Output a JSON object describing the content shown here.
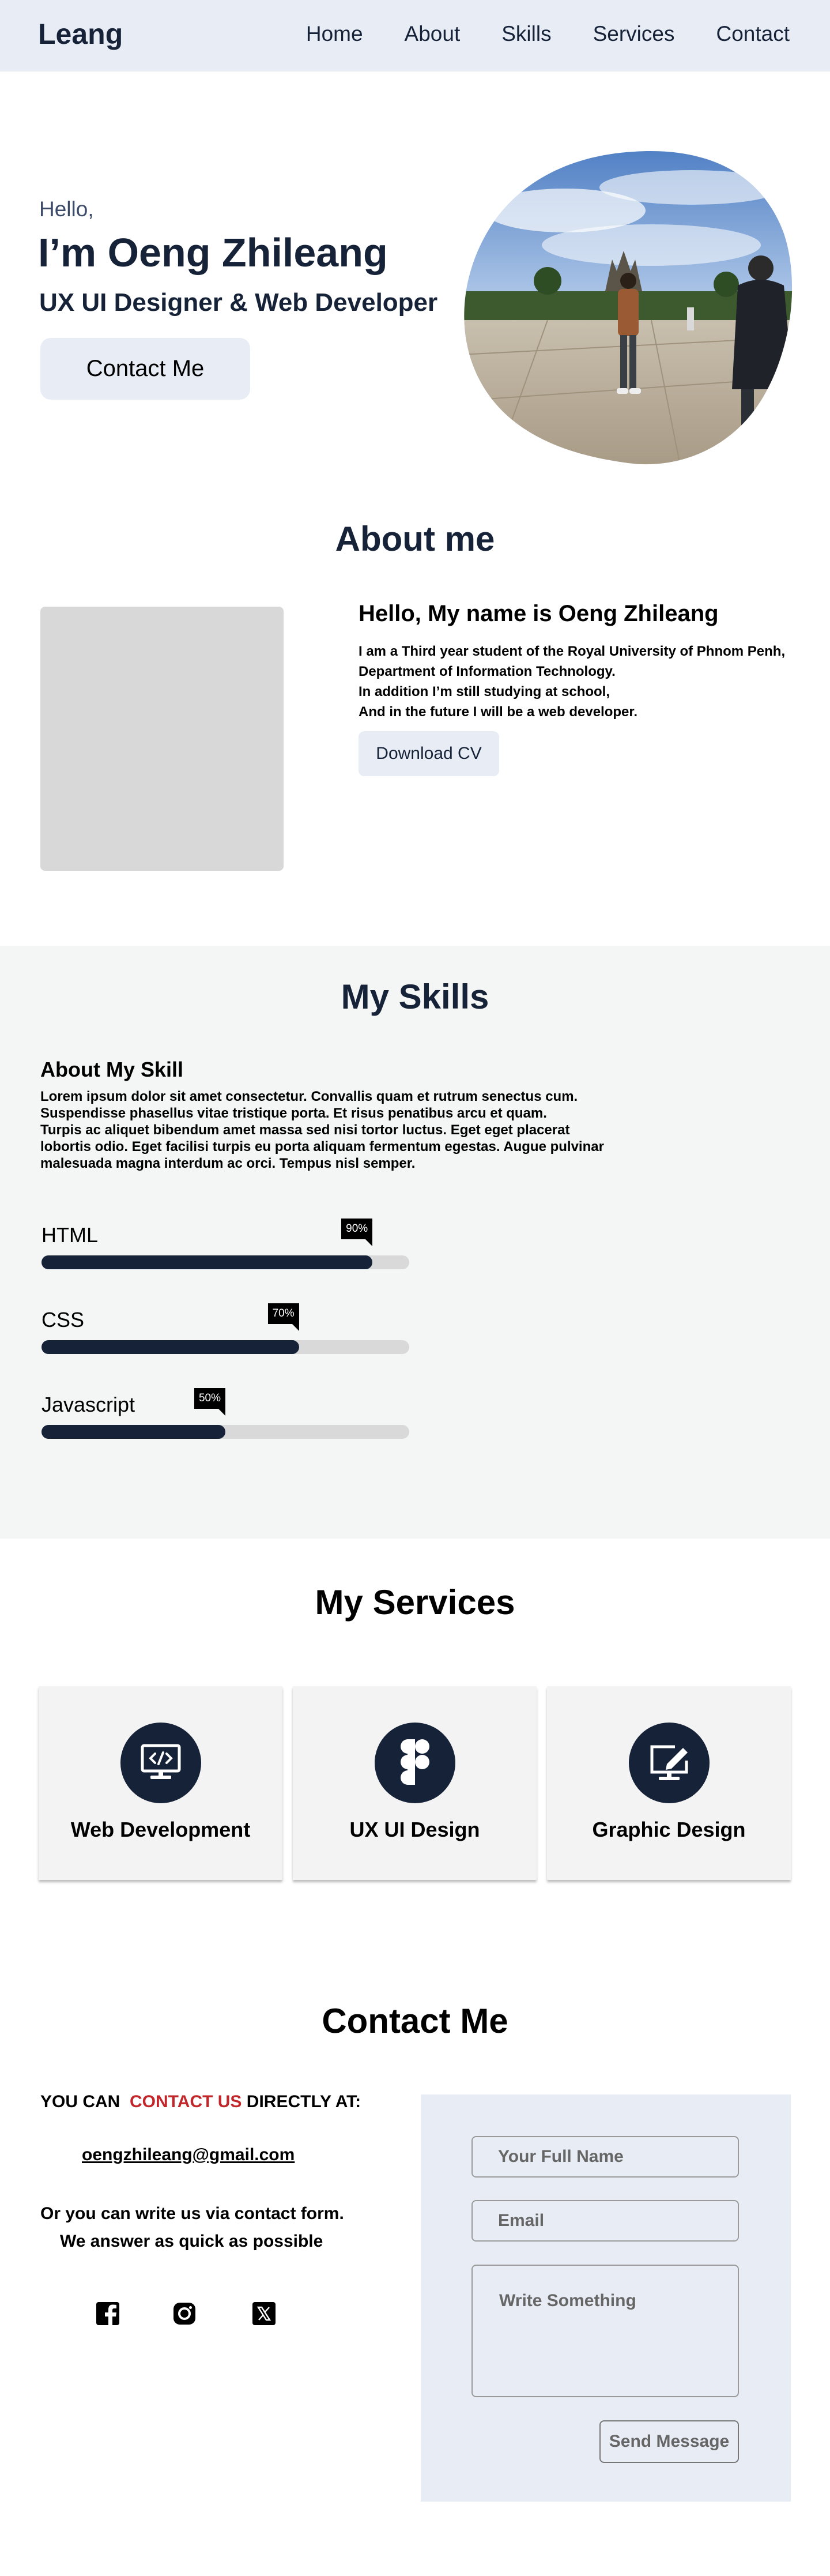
{
  "nav": {
    "logo": "Leang",
    "links": [
      "Home",
      "About",
      "Skills",
      "Services",
      "Contact"
    ]
  },
  "hero": {
    "greeting": "Hello,",
    "name": "I’m Oeng Zhileang",
    "role": "UX UI Designer & Web Developer",
    "button": "Contact Me"
  },
  "about": {
    "title": "About me",
    "heading": "Hello, My name is Oeng Zhileang",
    "lines": [
      "I am a Third year student of the Royal University of Phnom Penh,",
      "Department of Information Technology.",
      "In addition I’m still studying at school,",
      "And in the future I will be a web developer."
    ],
    "button": "Download CV"
  },
  "skills": {
    "title": "My Skills",
    "subtitle": "About My Skill",
    "description": [
      "Lorem ipsum dolor sit amet consectetur. Convallis quam et rutrum senectus cum.",
      "Suspendisse phasellus vitae tristique porta. Et risus penatibus arcu et quam.",
      "Turpis ac aliquet bibendum amet massa sed nisi tortor luctus. Eget eget placerat",
      "lobortis odio. Eget facilisi turpis eu porta aliquam fermentum egestas. Augue pulvinar",
      "malesuada magna interdum ac orci. Tempus nisl semper."
    ],
    "items": [
      {
        "name": "HTML",
        "percent": 90,
        "label": "90%"
      },
      {
        "name": "CSS",
        "percent": 70,
        "label": "70%"
      },
      {
        "name": "Javascript",
        "percent": 50,
        "label": "50%"
      }
    ]
  },
  "services": {
    "title": "My Services",
    "items": [
      {
        "label": "Web Development",
        "icon": "code-monitor-icon"
      },
      {
        "label": "UX UI Design",
        "icon": "figma-icon"
      },
      {
        "label": "Graphic Design",
        "icon": "design-pen-icon"
      }
    ]
  },
  "contact": {
    "title": "Contact Me",
    "line_start": "YOU CAN",
    "line_highlight": "CONTACT US",
    "line_end": "DIRECTLY AT:",
    "email": "oengzhileang@gmail.com",
    "or_text": "Or you can write us via contact form.",
    "answer_text": "We answer as quick as possible",
    "socials": [
      "facebook-icon",
      "instagram-icon",
      "x-twitter-icon"
    ],
    "form": {
      "name_placeholder": "Your Full Name",
      "email_placeholder": "Email",
      "message_placeholder": "Write Something",
      "send_label": "Send Message"
    }
  },
  "colors": {
    "navy": "#162238",
    "nav_bg": "#e8edf5",
    "section_bg": "#f4f5f5",
    "highlight_red": "#c0262a"
  }
}
